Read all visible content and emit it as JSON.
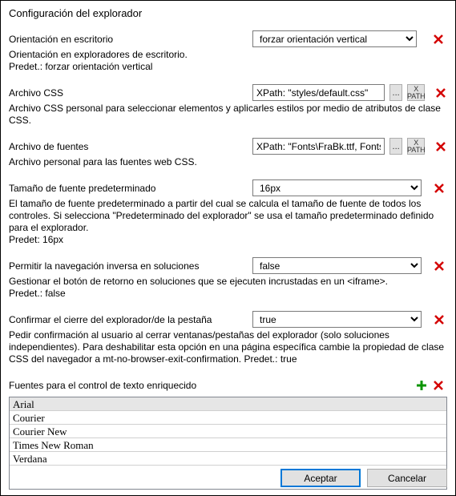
{
  "title": "Configuración del explorador",
  "orientation": {
    "label": "Orientación en escritorio",
    "value": "forzar orientación vertical",
    "desc": "Orientación en exploradores de escritorio.\nPredet.: forzar orientación vertical"
  },
  "cssfile": {
    "label": "Archivo CSS",
    "value": "XPath: \"styles/default.css\"",
    "browse": "...",
    "desc": "Archivo CSS personal para seleccionar elementos y aplicarles estilos por medio de atributos de clase CSS."
  },
  "fontfile": {
    "label": "Archivo de fuentes",
    "value": "XPath: \"Fonts\\FraBk.ttf, Fonts\\FraBkIt.ttf\"",
    "browse": "...",
    "desc": "Archivo personal para las fuentes web CSS."
  },
  "fontsize": {
    "label": "Tamaño de fuente predeterminado",
    "value": "16px",
    "desc": "El tamaño de fuente predeterminado a partir del cual se calcula el tamaño de fuente de todos los controles. Si selecciona \"Predeterminado del explorador\" se usa el tamaño predeterminado definido para el explorador.\nPredet: 16px"
  },
  "backnav": {
    "label": "Permitir la navegación inversa en soluciones",
    "value": "false",
    "desc": "Gestionar el botón de retorno en soluciones que se ejecuten incrustadas en un <iframe>.\nPredet.: false"
  },
  "confirmclose": {
    "label": "Confirmar el cierre del explorador/de la pestaña",
    "value": "true",
    "desc": "Pedir confirmación al usuario al cerrar ventanas/pestañas del explorador (solo soluciones independientes). Para deshabilitar esta opción en una página específica cambie la propiedad de clase CSS del navegador a mt-no-browser-exit-confirmation. Predet.: true"
  },
  "richfonts": {
    "label": "Fuentes para el control de texto enriquecido",
    "items": [
      "Arial",
      "Courier",
      "Courier New",
      "Times New Roman",
      "Verdana"
    ]
  },
  "buttons": {
    "ok": "Aceptar",
    "cancel": "Cancelar"
  }
}
